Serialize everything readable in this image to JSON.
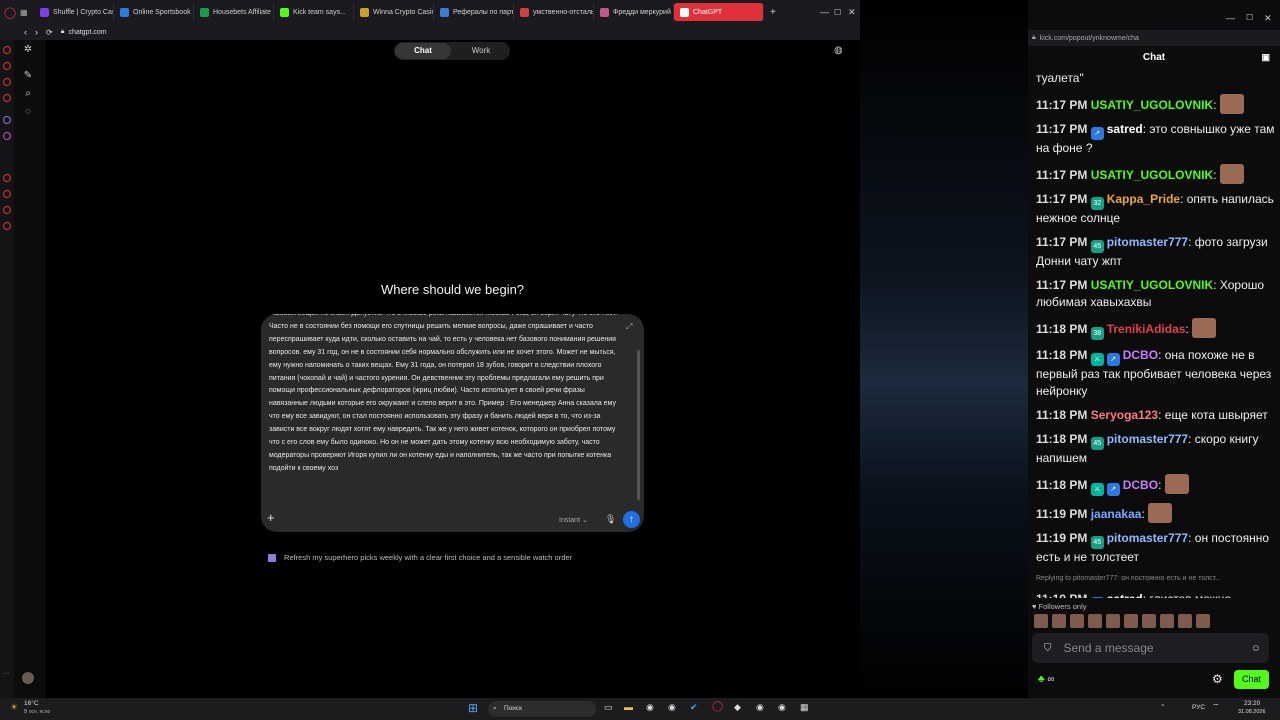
{
  "browser": {
    "tabs": [
      {
        "label": "Shuffle | Crypto Casi",
        "color": "#7b3fe4"
      },
      {
        "label": "Online Sportsbook -",
        "color": "#2a7ae2"
      },
      {
        "label": "Housebets Affiliate F",
        "color": "#1a9c4a"
      },
      {
        "label": "Kick team says...",
        "color": "#53fc18"
      },
      {
        "label": "Winna Crypto Casino",
        "color": "#c9a227"
      },
      {
        "label": "Рефералы по партн",
        "color": "#3a7bd5"
      },
      {
        "label": "умственно-отсталый",
        "color": "#d04040"
      },
      {
        "label": "Фредди меркурий",
        "color": "#c05a8a"
      },
      {
        "label": "ChatGPT",
        "color": "#ffffff"
      }
    ],
    "url": "chatgpt.com"
  },
  "chatgpt": {
    "mode_chat": "Chat",
    "mode_work": "Work",
    "greeting": "Where should we begin?",
    "prompt_text": "базовых вещей не знает. Допустим что в Москве река называется Москва-Река, он верит чату что это Нил. Часто не в состоянии без помощи его спутницы решить мелкие вопросы, даже спрашивает и часто переспрашивает куда идти, сколько оставить на чай, то есть у человека нет базового понимания решения вопросов. ему 31 год, он не в состоянии себя нормально обслужить или не хочет этого. Может не мыться, ему нужно напоминать о таких вещах. Ему 31 года, он потерял 18 зубов, говорит в следствии плохого питания (чокопай и чай) и частого курения. Он девственник эту проблемы предлагали ему решить при помощи профессиональных дефлораторов (жриц любви). Часто использует в своей речи фразы навязанные людьми которые его окружают и слепо верит в это. Пример : Его менеджер Анна сказала ему что ему все завидуют, он стал постоянно использовать эту фразу и банить людей веря в то, что из-за зависти все вокруг людят хотят ему навредить. Так же у него живет котенок, которого он приобрел потому что с его слов ему было одиноко. Но он не может дать этому котенку всю необходимую заботу, часто модераторы проверяют Игоря купил ли он котенку еды и наполнитель, так же часто при попытке котенка подойти к своему хоз",
    "model_label": "Instant",
    "suggestion": "Refresh my superhero picks weekly with a clear first choice and a sensible watch order"
  },
  "kick": {
    "url": "kick.com/popout/ynknowme/cha",
    "title": "Chat",
    "top_fragment": "туалета\"",
    "messages": [
      {
        "time": "11:17 PM",
        "user": "USATIY_UGOLOVNIK",
        "color": "#53fc18",
        "badges": [],
        "text": "",
        "emote": true
      },
      {
        "time": "11:17 PM",
        "user": "satred",
        "color": "#ffffff",
        "badges": [
          "blue"
        ],
        "text": "это совнышко уже там на фоне ?",
        "emote": false
      },
      {
        "time": "11:17 PM",
        "user": "USATIY_UGOLOVNIK",
        "color": "#53fc18",
        "badges": [],
        "text": "",
        "emote": true
      },
      {
        "time": "11:17 PM",
        "user": "Kappa_Pride",
        "color": "#e8a838",
        "badges": [
          "32"
        ],
        "text": "опять напилась нежное солнце",
        "emote": false
      },
      {
        "time": "11:17 PM",
        "user": "pitomaster777",
        "color": "#8fb8ff",
        "badges": [
          "45"
        ],
        "text": "фото загрузи Донни чату жпт",
        "emote": false
      },
      {
        "time": "11:17 PM",
        "user": "USATIY_UGOLOVNIK",
        "color": "#53fc18",
        "badges": [],
        "text": "Хорошо любимая хавыхахвы",
        "emote": false
      },
      {
        "time": "11:18 PM",
        "user": "TrenikiAdidas",
        "color": "#e0404a",
        "badges": [
          "38"
        ],
        "text": "",
        "emote": true
      },
      {
        "time": "11:18 PM",
        "user": "DCBO",
        "color": "#c77dff",
        "badges": [
          "mod",
          "blue"
        ],
        "text": "она похоже не в первый раз так пробивает человека через нейронку",
        "emote": false
      },
      {
        "time": "11:18 PM",
        "user": "Seryoga123",
        "color": "#ff7a7a",
        "badges": [],
        "text": "еще кота швыряет",
        "emote": false
      },
      {
        "time": "11:18 PM",
        "user": "pitomaster777",
        "color": "#8fb8ff",
        "badges": [
          "45"
        ],
        "text": "скоро книгу напишем",
        "emote": false
      },
      {
        "time": "11:18 PM",
        "user": "DCBO",
        "color": "#c77dff",
        "badges": [
          "mod",
          "blue"
        ],
        "text": "",
        "emote": true
      },
      {
        "time": "11:19 PM",
        "user": "jaanakaa",
        "color": "#7aa8ff",
        "badges": [],
        "text": "",
        "emote": true
      },
      {
        "time": "11:19 PM",
        "user": "pitomaster777",
        "color": "#8fb8ff",
        "badges": [
          "45"
        ],
        "text": "он постоянно есть и не толстеет",
        "emote": false
      },
      {
        "time": "11:19 PM",
        "user": "satred",
        "color": "#ffffff",
        "badges": [
          "blue"
        ],
        "text": "глистов можно определить и без чата ГПТ",
        "emote": false,
        "reply": "Replying to pitomaster777: он постоянно есть и не толст..."
      }
    ],
    "followers_only": "Followers only",
    "placeholder": "Send a message",
    "chat_button": "Chat"
  },
  "taskbar": {
    "weather_temp": "16°C",
    "weather_desc": "В осн. ясно",
    "search": "Поиск",
    "lang": "РУС",
    "time": "23:20",
    "date": "31.08.2026"
  }
}
